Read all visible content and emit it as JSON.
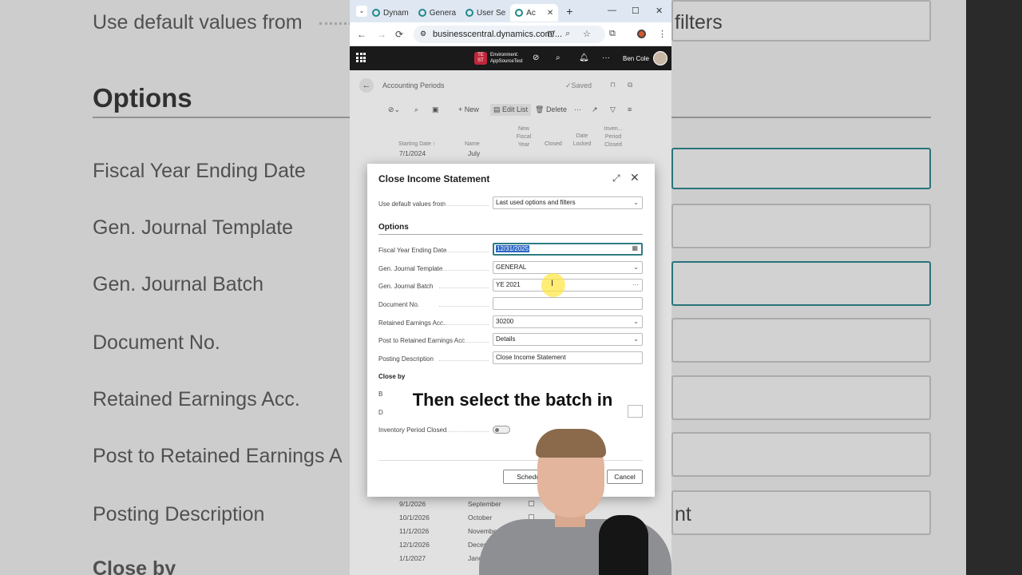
{
  "background": {
    "rows": [
      "Use default values from",
      "Fiscal Year Ending Date",
      "Gen. Journal Template",
      "Gen. Journal Batch",
      "Document No.",
      "Retained Earnings Acc.",
      "Post to Retained Earnings A",
      "Posting Description",
      "Close by"
    ],
    "section": "Options",
    "right_texts": [
      "filters",
      "nt"
    ]
  },
  "browser": {
    "tabs": [
      "Dynam",
      "Genera",
      "User Se",
      "Ac"
    ],
    "url": "businesscentral.dynamics.com/...",
    "nav": {
      "back": "←",
      "forward": "→",
      "reload": "⟳"
    }
  },
  "bc_header": {
    "env_badge": "TE ST",
    "env_label": "Environment:",
    "env_name": "AppSourceTest",
    "user": "Ben Cole"
  },
  "list_page": {
    "title": "Accounting Periods",
    "saved": "✓Saved",
    "toolbar": {
      "new": "+ New",
      "edit_list": "Edit List",
      "delete": "Delete"
    },
    "columns": {
      "starting_date": "Starting Date ↑",
      "name": "Name",
      "new_fiscal_year": "New Fiscal Year",
      "closed": "Closed",
      "date_locked": "Date Locked",
      "inventory_period_closed": "Inven... Period Closed"
    },
    "rows_top": [
      {
        "date": "7/1/2024",
        "name": "July"
      }
    ],
    "rows_bottom": [
      {
        "date": "9/1/2026",
        "name": "September"
      },
      {
        "date": "10/1/2026",
        "name": "October"
      },
      {
        "date": "11/1/2026",
        "name": "November"
      },
      {
        "date": "12/1/2026",
        "name": "December"
      },
      {
        "date": "1/1/2027",
        "name": "January"
      }
    ]
  },
  "dialog": {
    "title": "Close Income Statement",
    "use_default_label": "Use default values from",
    "use_default_value": "Last used options and filters",
    "options_heading": "Options",
    "fields": {
      "fiscal_year_label": "Fiscal Year Ending Date",
      "fiscal_year_value": "12/31/2025",
      "template_label": "Gen. Journal Template",
      "template_value": "GENERAL",
      "batch_label": "Gen. Journal Batch",
      "batch_value": "YE 2021",
      "doc_no_label": "Document No.",
      "doc_no_value": "",
      "retained_label": "Retained Earnings Acc.",
      "retained_value": "30200",
      "post_to_label": "Post to Retained Earnings Acc.",
      "post_to_value": "Details",
      "posting_desc_label": "Posting Description",
      "posting_desc_value": "Close Income Statement"
    },
    "close_by_heading": "Close by",
    "close_by_partial_1": "B",
    "close_by_partial_2": "D",
    "inventory_label": "Inventory Period Closed",
    "buttons": {
      "schedule": "Schedule",
      "cancel": "Cancel"
    }
  },
  "caption": "Then select the batch in"
}
